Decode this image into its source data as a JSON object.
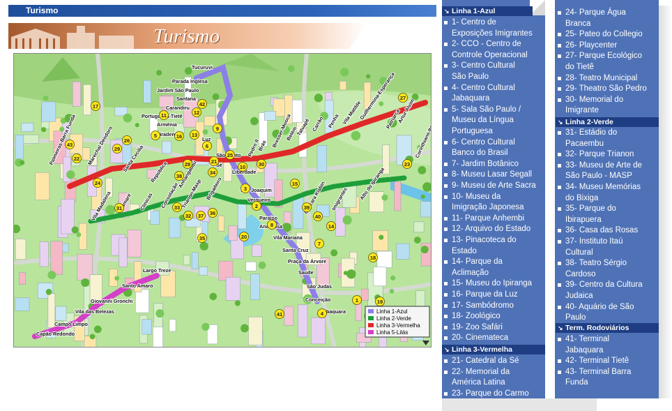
{
  "topbar": {
    "title": "Turismo"
  },
  "banner": {
    "title": "Turismo"
  },
  "map": {
    "stations_left": [
      "Tucuruvi",
      "Parada Inglesa",
      "Jardim São Paulo",
      "Santana",
      "Carandiru",
      "Portuguesa-Tietê",
      "Armênia",
      "Tiradentes",
      "Luz",
      "São Bento",
      "Sé",
      "Liberdade",
      "São Joaquim",
      "Vergueiro",
      "Paraíso",
      "Ana Rosa",
      "Vila Mariana",
      "Santa Cruz",
      "Praça da Árvore",
      "Saúde",
      "São Judas",
      "Conceição",
      "Jabaquara"
    ],
    "stations_red": [
      "Palmeiras-Barra Funda",
      "Marechal Deodoro",
      "Santa Cecília",
      "República",
      "Anhangabaú",
      "Pedro II",
      "Brás",
      "Bresser-Mooca",
      "Belém",
      "Tatuapé",
      "Carrão",
      "Penha",
      "Vila Matilde",
      "Guilhermina-Esperança",
      "Patriarca",
      "Artur Alvim",
      "Corinthians-Itaquera"
    ],
    "stations_green": [
      "Vila Madalena",
      "Sumaré",
      "Clínicas",
      "Consolação",
      "Trianon-Masp",
      "Brigadeiro",
      "Chácara Klabin",
      "Imigrantes",
      "Alto do Ipiranga"
    ],
    "stations_lilac": [
      "Largo Treze",
      "Santo Amaro",
      "Giovanni Gronchi",
      "Vila das Belezas",
      "Campo Limpo",
      "Capão Redondo"
    ],
    "markers": [
      "1",
      "2",
      "3",
      "4",
      "5",
      "6",
      "7",
      "8",
      "9",
      "10",
      "11",
      "12",
      "13",
      "14",
      "15",
      "16",
      "17",
      "18",
      "19",
      "20",
      "21",
      "22",
      "23",
      "24",
      "25",
      "26",
      "27",
      "28",
      "29",
      "30",
      "31",
      "32",
      "33",
      "34",
      "35",
      "36",
      "37",
      "38",
      "39",
      "40",
      "41",
      "42",
      "43"
    ],
    "legend": [
      "Linha 1-Azul",
      "Linha 2-Verde",
      "Linha 3-Vermelha",
      "Linha 5-Lilás"
    ],
    "colors": {
      "blue": "#8c7fe6",
      "green": "#1e9e3a",
      "red": "#e02828",
      "lilac": "#d440c8"
    }
  },
  "sections": {
    "linha1": "Linha 1-Azul",
    "linha2": "Linha 2-Verde",
    "linha3": "Linha 3-Vermelha",
    "terminais": "Term. Rodoviários"
  },
  "items": [
    [
      "1- Centro de",
      "Exposições Imigrantes"
    ],
    [
      "2- CCO - Centro de",
      "Controle Operacional"
    ],
    [
      "3- Centro Cultural",
      "São Paulo"
    ],
    [
      "4- Centro Cultural",
      "Jabaquara"
    ],
    [
      "5- Sala São Paulo /",
      "Museu da Língua",
      "Portuguesa"
    ],
    [
      "6- Centro Cultural",
      "Banco do Brasil"
    ],
    [
      "7- Jardim Botânico"
    ],
    [
      "8- Museu Lasar Segall"
    ],
    [
      "9- Museu de Arte Sacra"
    ],
    [
      "10- Museu da",
      "Imigração Japonesa"
    ],
    [
      "11- Parque Anhembi"
    ],
    [
      "12- Arquivo do Estado"
    ],
    [
      "13- Pinacoteca do",
      "Estado"
    ],
    [
      "14- Parque da",
      "Aclimação"
    ],
    [
      "15- Museu do Ipiranga"
    ],
    [
      "16- Parque da Luz"
    ],
    [
      "17- Sambódromo"
    ],
    [
      "18- Zoológico"
    ],
    [
      "19- Zoo Safári"
    ],
    [
      "20- Cinemateca"
    ],
    [
      "21- Catedral da Sé"
    ],
    [
      "22- Memorial da",
      "América Latina"
    ],
    [
      "23- Parque do Carmo"
    ],
    [
      "24- Parque Água",
      "Branca"
    ],
    [
      "25- Pateo do Collegio"
    ],
    [
      "26- Playcenter"
    ],
    [
      "27- Parque Ecológico",
      "do Tietê"
    ],
    [
      "28- Teatro Municipal"
    ],
    [
      "29- Theatro São Pedro"
    ],
    [
      "30- Memorial do",
      "Imigrante"
    ],
    [
      "31- Estádio do",
      "Pacaembu"
    ],
    [
      "32- Parque Trianon"
    ],
    [
      "33- Museu de Arte de",
      "São Paulo - MASP"
    ],
    [
      "34- Museu Memórias",
      "do Bixiga"
    ],
    [
      "35- Parque do",
      "Ibirapuera"
    ],
    [
      "36- Casa das Rosas"
    ],
    [
      "37- Instituto Itaú",
      "Cultural"
    ],
    [
      "38- Teatro Sérgio",
      "Cardoso"
    ],
    [
      "39- Centro da Cultura",
      "Judaica"
    ],
    [
      "40- Aquário de São",
      "Paulo"
    ],
    [
      "41- Terminal",
      "Jabaquara"
    ],
    [
      "42- Terminal Tietê"
    ],
    [
      "43- Terminal Barra",
      "Funda"
    ]
  ]
}
